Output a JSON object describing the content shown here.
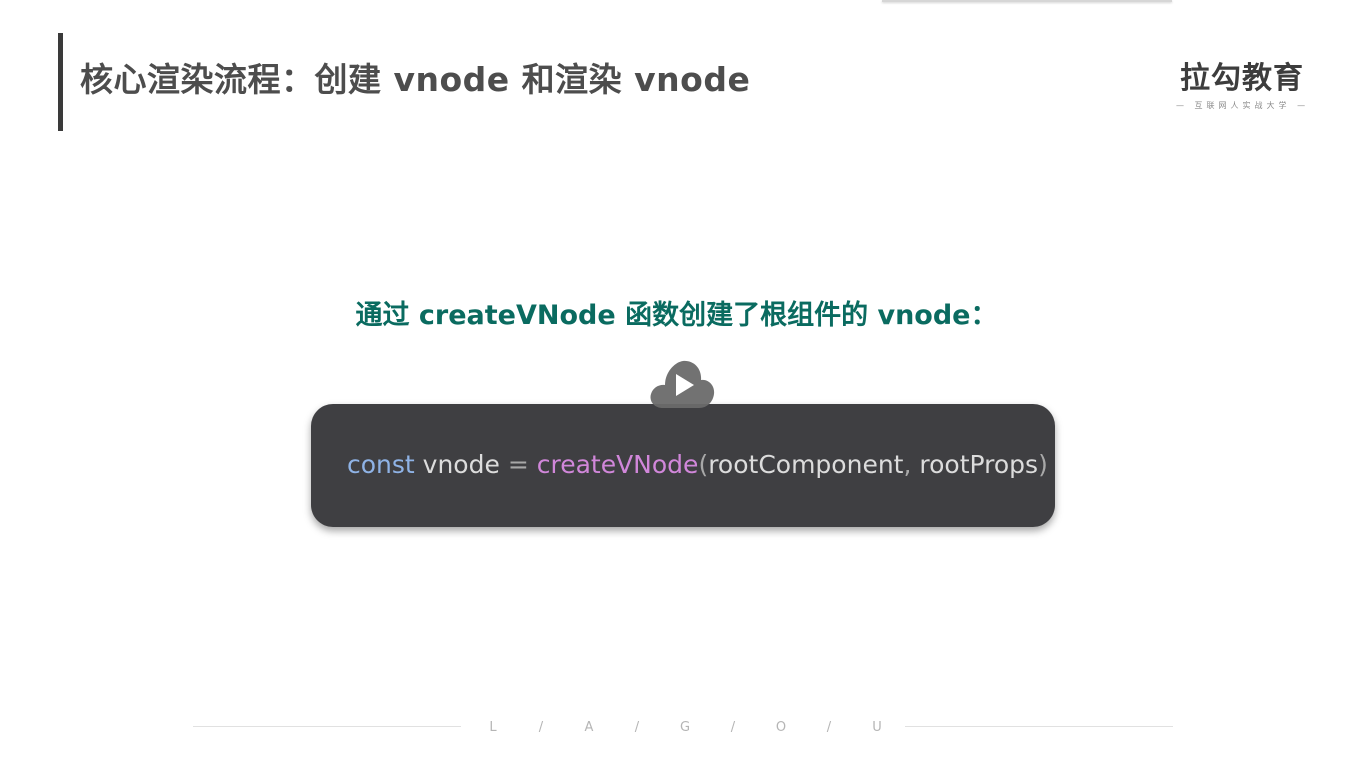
{
  "slide": {
    "title": "核心渲染流程：创建 vnode 和渲染 vnode",
    "subtitle": "通过 createVNode 函数创建了根组件的 vnode："
  },
  "logo": {
    "name": "拉勾教育",
    "tagline": "— 互联网人实战大学 —"
  },
  "code": {
    "keyword": "const",
    "variable": "vnode",
    "operator": "=",
    "function": "createVNode",
    "open_paren": "(",
    "arg1": "rootComponent",
    "comma": ",",
    "arg2": "rootProps",
    "close_paren": ")"
  },
  "footer": {
    "letters": [
      "L",
      "/",
      "A",
      "/",
      "G",
      "/",
      "O",
      "/",
      "U"
    ]
  },
  "colors": {
    "title": "#4d4d4d",
    "subtitle": "#0a6b60",
    "code_background": "#3f3f42",
    "keyword": "#8fb3e6",
    "function": "#d187da",
    "identifier": "#dcdcdc"
  },
  "icons": {
    "player": "play-icon"
  }
}
